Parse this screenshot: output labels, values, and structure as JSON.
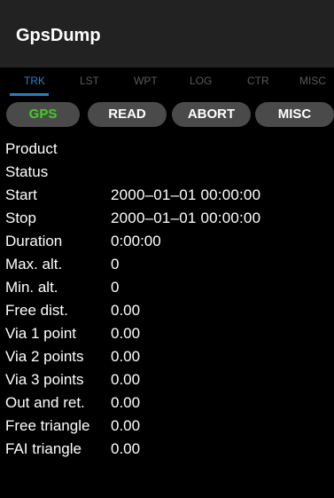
{
  "app": {
    "title": "GpsDump"
  },
  "tabs": [
    {
      "label": "TRK",
      "active": true
    },
    {
      "label": "LST"
    },
    {
      "label": "WPT"
    },
    {
      "label": "LOG"
    },
    {
      "label": "CTR"
    },
    {
      "label": "MISC"
    }
  ],
  "buttons": {
    "gps": "GPS",
    "read": "READ",
    "abort": "ABORT",
    "misc": "MISC"
  },
  "colors": {
    "accent": "#1f84c7",
    "gps_green": "#3ed11f",
    "button_bg": "#4a4a4a",
    "appbar_bg": "#222222",
    "tab_inactive": "#5a5a5a"
  },
  "fields": [
    {
      "label": "Product",
      "value": ""
    },
    {
      "label": "Status",
      "value": ""
    },
    {
      "label": "Start",
      "value": "2000–01–01 00:00:00"
    },
    {
      "label": "Stop",
      "value": "2000–01–01 00:00:00"
    },
    {
      "label": "Duration",
      "value": "0:00:00"
    },
    {
      "label": "Max. alt.",
      "value": "0"
    },
    {
      "label": "Min. alt.",
      "value": "0"
    },
    {
      "label": "Free dist.",
      "value": "0.00"
    },
    {
      "label": "Via 1 point",
      "value": "0.00"
    },
    {
      "label": "Via 2 points",
      "value": "0.00"
    },
    {
      "label": "Via 3 points",
      "value": "0.00"
    },
    {
      "label": "Out and ret.",
      "value": "0.00"
    },
    {
      "label": "Free triangle",
      "value": "0.00"
    },
    {
      "label": "FAI triangle",
      "value": "0.00"
    }
  ]
}
